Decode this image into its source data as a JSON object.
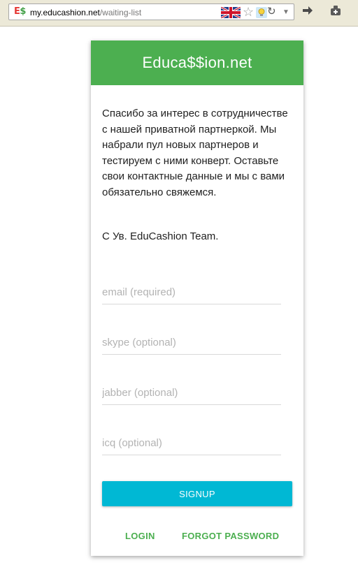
{
  "browser": {
    "favicon_e": "E",
    "favicon_s": "$",
    "url_domain": "my.educashion.net",
    "url_path": "/waiting-list"
  },
  "card": {
    "title": "Educa$$ion.net",
    "message": "Спасибо за интерес в сотрудничестве с нашей приватной партнеркой. Мы набрали пул новых партнеров и тестируем с ними конверт. Оставьте свои контактные данные и мы с вами обязательно свяжемся.",
    "signature": "С Ув. EduCashion Team."
  },
  "form": {
    "email_placeholder": "email (required)",
    "skype_placeholder": "skype (optional)",
    "jabber_placeholder": "jabber (optional)",
    "icq_placeholder": "icq (optional)",
    "signup_label": "SIGNUP"
  },
  "links": {
    "login": "LOGIN",
    "forgot_password": "FORGOT PASSWORD"
  },
  "colors": {
    "header_green": "#4caf50",
    "signup_cyan": "#00b8d4",
    "link_green": "#4caf50"
  }
}
